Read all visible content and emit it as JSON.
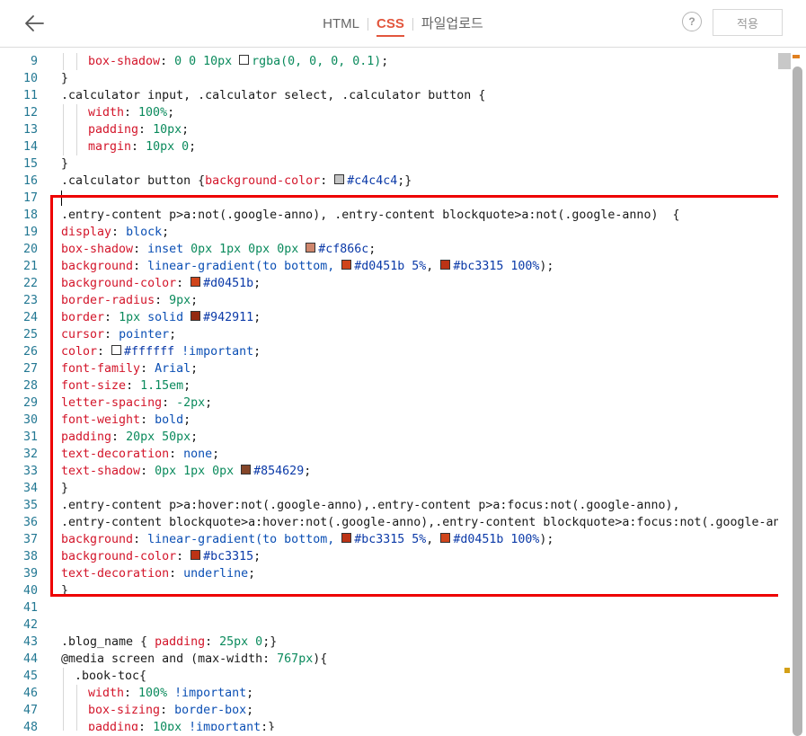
{
  "toolbar": {
    "tabs": [
      {
        "label": "HTML",
        "active": false
      },
      {
        "label": "CSS",
        "active": true
      },
      {
        "label": "파일업로드",
        "active": false
      }
    ],
    "help_label": "?",
    "apply_label": "적용"
  },
  "colors": {
    "accent": "#e2563d",
    "highlight_border": "#ee0000",
    "line_number": "#237893",
    "property": "#d3152a",
    "value": "#0b4fb4"
  },
  "lines": [
    {
      "n": "9",
      "indent": 2,
      "tokens": [
        [
          "p",
          "box-shadow"
        ],
        [
          "t",
          ": "
        ],
        [
          "m",
          "0 0 10px "
        ],
        [
          "sw",
          "#ffffff"
        ],
        [
          "m",
          "rgba(0, 0, 0, 0.1)"
        ],
        [
          "t",
          ";"
        ]
      ]
    },
    {
      "n": "10",
      "indent": 0,
      "tokens": [
        [
          "t",
          "}"
        ]
      ]
    },
    {
      "n": "11",
      "indent": 0,
      "tokens": [
        [
          "t",
          ".calculator input, .calculator select, .calculator button {"
        ]
      ]
    },
    {
      "n": "12",
      "indent": 2,
      "tokens": [
        [
          "p",
          "width"
        ],
        [
          "t",
          ": "
        ],
        [
          "m",
          "100%"
        ],
        [
          "t",
          ";"
        ]
      ]
    },
    {
      "n": "13",
      "indent": 2,
      "tokens": [
        [
          "p",
          "padding"
        ],
        [
          "t",
          ": "
        ],
        [
          "m",
          "10px"
        ],
        [
          "t",
          ";"
        ]
      ]
    },
    {
      "n": "14",
      "indent": 2,
      "tokens": [
        [
          "p",
          "margin"
        ],
        [
          "t",
          ": "
        ],
        [
          "m",
          "10px 0"
        ],
        [
          "t",
          ";"
        ]
      ]
    },
    {
      "n": "15",
      "indent": 0,
      "tokens": [
        [
          "t",
          "}"
        ]
      ]
    },
    {
      "n": "16",
      "indent": 0,
      "tokens": [
        [
          "t",
          ".calculator button {"
        ],
        [
          "p",
          "background-color"
        ],
        [
          "t",
          ": "
        ],
        [
          "sw",
          "#c4c4c4"
        ],
        [
          "h",
          "#c4c4c4"
        ],
        [
          "t",
          ";}"
        ]
      ]
    },
    {
      "n": "17",
      "indent": 0,
      "tokens": []
    },
    {
      "n": "18",
      "indent": 0,
      "tokens": [
        [
          "t",
          ".entry-content p>a:not(.google-anno), .entry-content blockquote>a:not(.google-anno)  {"
        ]
      ]
    },
    {
      "n": "19",
      "indent": 0,
      "tokens": [
        [
          "p",
          "display"
        ],
        [
          "t",
          ": "
        ],
        [
          "v",
          "block"
        ],
        [
          "t",
          ";"
        ]
      ]
    },
    {
      "n": "20",
      "indent": 0,
      "tokens": [
        [
          "p",
          "box-shadow"
        ],
        [
          "t",
          ": "
        ],
        [
          "v",
          "inset "
        ],
        [
          "m",
          "0px 1px 0px 0px "
        ],
        [
          "sw",
          "#cf866c"
        ],
        [
          "h",
          "#cf866c"
        ],
        [
          "t",
          ";"
        ]
      ]
    },
    {
      "n": "21",
      "indent": 0,
      "tokens": [
        [
          "p",
          "background"
        ],
        [
          "t",
          ": "
        ],
        [
          "v",
          "linear-gradient(to bottom, "
        ],
        [
          "sw",
          "#d0451b"
        ],
        [
          "h",
          "#d0451b 5%"
        ],
        [
          "t",
          ", "
        ],
        [
          "sw",
          "#bc3315"
        ],
        [
          "h",
          "#bc3315 100%"
        ],
        [
          "t",
          ");"
        ]
      ]
    },
    {
      "n": "22",
      "indent": 0,
      "tokens": [
        [
          "p",
          "background-color"
        ],
        [
          "t",
          ": "
        ],
        [
          "sw",
          "#d0451b"
        ],
        [
          "h",
          "#d0451b"
        ],
        [
          "t",
          ";"
        ]
      ]
    },
    {
      "n": "23",
      "indent": 0,
      "tokens": [
        [
          "p",
          "border-radius"
        ],
        [
          "t",
          ": "
        ],
        [
          "m",
          "9px"
        ],
        [
          "t",
          ";"
        ]
      ]
    },
    {
      "n": "24",
      "indent": 0,
      "tokens": [
        [
          "p",
          "border"
        ],
        [
          "t",
          ": "
        ],
        [
          "m",
          "1px "
        ],
        [
          "v",
          "solid "
        ],
        [
          "sw",
          "#942911"
        ],
        [
          "h",
          "#942911"
        ],
        [
          "t",
          ";"
        ]
      ]
    },
    {
      "n": "25",
      "indent": 0,
      "tokens": [
        [
          "p",
          "cursor"
        ],
        [
          "t",
          ": "
        ],
        [
          "v",
          "pointer"
        ],
        [
          "t",
          ";"
        ]
      ]
    },
    {
      "n": "26",
      "indent": 0,
      "tokens": [
        [
          "p",
          "color"
        ],
        [
          "t",
          ": "
        ],
        [
          "sw",
          "#ffffff"
        ],
        [
          "h",
          "#ffffff "
        ],
        [
          "v",
          "!important"
        ],
        [
          "t",
          ";"
        ]
      ]
    },
    {
      "n": "27",
      "indent": 0,
      "tokens": [
        [
          "p",
          "font-family"
        ],
        [
          "t",
          ": "
        ],
        [
          "v",
          "Arial"
        ],
        [
          "t",
          ";"
        ]
      ]
    },
    {
      "n": "28",
      "indent": 0,
      "tokens": [
        [
          "p",
          "font-size"
        ],
        [
          "t",
          ": "
        ],
        [
          "m",
          "1.15em"
        ],
        [
          "t",
          ";"
        ]
      ]
    },
    {
      "n": "29",
      "indent": 0,
      "tokens": [
        [
          "p",
          "letter-spacing"
        ],
        [
          "t",
          ": "
        ],
        [
          "m",
          "-2px"
        ],
        [
          "t",
          ";"
        ]
      ]
    },
    {
      "n": "30",
      "indent": 0,
      "tokens": [
        [
          "p",
          "font-weight"
        ],
        [
          "t",
          ": "
        ],
        [
          "v",
          "bold"
        ],
        [
          "t",
          ";"
        ]
      ]
    },
    {
      "n": "31",
      "indent": 0,
      "tokens": [
        [
          "p",
          "padding"
        ],
        [
          "t",
          ": "
        ],
        [
          "m",
          "20px 50px"
        ],
        [
          "t",
          ";"
        ]
      ]
    },
    {
      "n": "32",
      "indent": 0,
      "tokens": [
        [
          "p",
          "text-decoration"
        ],
        [
          "t",
          ": "
        ],
        [
          "v",
          "none"
        ],
        [
          "t",
          ";"
        ]
      ]
    },
    {
      "n": "33",
      "indent": 0,
      "tokens": [
        [
          "p",
          "text-shadow"
        ],
        [
          "t",
          ": "
        ],
        [
          "m",
          "0px 1px 0px "
        ],
        [
          "sw",
          "#854629"
        ],
        [
          "h",
          "#854629"
        ],
        [
          "t",
          ";"
        ]
      ]
    },
    {
      "n": "34",
      "indent": 0,
      "tokens": [
        [
          "t",
          "}"
        ]
      ]
    },
    {
      "n": "35",
      "indent": 0,
      "tokens": [
        [
          "t",
          ".entry-content p>a:hover:not(.google-anno),.entry-content p>a:focus:not(.google-anno),"
        ]
      ]
    },
    {
      "n": "36",
      "indent": 0,
      "tokens": [
        [
          "t",
          ".entry-content blockquote>a:hover:not(.google-anno),.entry-content blockquote>a:focus:not(.google-anno) {"
        ]
      ]
    },
    {
      "n": "37",
      "indent": 0,
      "tokens": [
        [
          "p",
          "background"
        ],
        [
          "t",
          ": "
        ],
        [
          "v",
          "linear-gradient(to bottom, "
        ],
        [
          "sw",
          "#bc3315"
        ],
        [
          "h",
          "#bc3315 5%"
        ],
        [
          "t",
          ", "
        ],
        [
          "sw",
          "#d0451b"
        ],
        [
          "h",
          "#d0451b 100%"
        ],
        [
          "t",
          ");"
        ]
      ]
    },
    {
      "n": "38",
      "indent": 0,
      "tokens": [
        [
          "p",
          "background-color"
        ],
        [
          "t",
          ": "
        ],
        [
          "sw",
          "#bc3315"
        ],
        [
          "h",
          "#bc3315"
        ],
        [
          "t",
          ";"
        ]
      ]
    },
    {
      "n": "39",
      "indent": 0,
      "tokens": [
        [
          "p",
          "text-decoration"
        ],
        [
          "t",
          ": "
        ],
        [
          "v",
          "underline"
        ],
        [
          "t",
          ";"
        ]
      ]
    },
    {
      "n": "40",
      "indent": 0,
      "tokens": [
        [
          "t",
          "}"
        ]
      ]
    },
    {
      "n": "41",
      "indent": 0,
      "tokens": []
    },
    {
      "n": "42",
      "indent": 0,
      "tokens": []
    },
    {
      "n": "43",
      "indent": 0,
      "tokens": [
        [
          "t",
          ".blog_name { "
        ],
        [
          "p",
          "padding"
        ],
        [
          "t",
          ": "
        ],
        [
          "m",
          "25px 0"
        ],
        [
          "t",
          ";}"
        ]
      ]
    },
    {
      "n": "44",
      "indent": 0,
      "tokens": [
        [
          "t",
          "@media screen and (max-width: "
        ],
        [
          "m",
          "767px"
        ],
        [
          "t",
          "){"
        ]
      ]
    },
    {
      "n": "45",
      "indent": 1,
      "tokens": [
        [
          "t",
          ".book-toc{"
        ]
      ]
    },
    {
      "n": "46",
      "indent": 2,
      "tokens": [
        [
          "p",
          "width"
        ],
        [
          "t",
          ": "
        ],
        [
          "m",
          "100% "
        ],
        [
          "v",
          "!important"
        ],
        [
          "t",
          ";"
        ]
      ]
    },
    {
      "n": "47",
      "indent": 2,
      "tokens": [
        [
          "p",
          "box-sizing"
        ],
        [
          "t",
          ": "
        ],
        [
          "v",
          "border-box"
        ],
        [
          "t",
          ";"
        ]
      ]
    },
    {
      "n": "48",
      "indent": 2,
      "tokens": [
        [
          "p",
          "padding"
        ],
        [
          "t",
          ": "
        ],
        [
          "m",
          "10px "
        ],
        [
          "v",
          "!important"
        ],
        [
          "t",
          ";}"
        ]
      ]
    }
  ]
}
